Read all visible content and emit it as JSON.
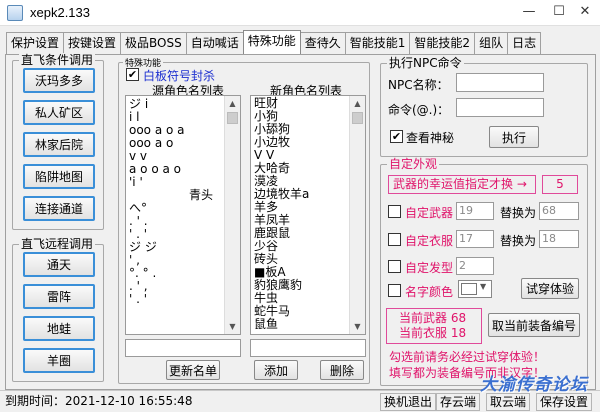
{
  "window": {
    "title": "xepk2.133",
    "minimize": "—",
    "maximize": "☐",
    "close": "✕"
  },
  "tabs": [
    "保护设置",
    "按键设置",
    "极品BOSS",
    "自动喊话",
    "特殊功能",
    "查待久",
    "智能技能1",
    "智能技能2",
    "组队",
    "日志"
  ],
  "active_tab": "特殊功能",
  "left_panel": {
    "group1_title": "直飞条件调用",
    "group1_buttons": [
      "沃玛多多",
      "私人矿区",
      "林家后院",
      "陷阱地图",
      "连接通道"
    ],
    "group2_title": "直飞远程调用",
    "group2_buttons": [
      "通天",
      "雷阵",
      "地蛙",
      "羊圈"
    ]
  },
  "special": {
    "group_title": "特殊功能",
    "white_board_check": "✔",
    "white_board_label": "白板符号封杀",
    "source_list_header": "源角色名列表",
    "source_list_items": [
      "ジ i",
      "i l",
      "ooo a o a",
      "ooo a o",
      "v v",
      "a o o a o",
      " 'i '",
      "青头",
      "へ°",
      ". ' .",
      "' . '",
      "ジ ジ",
      "' ,",
      "°. ° .",
      ". ' ,",
      "' . '"
    ],
    "source_highlight": "青头",
    "new_list_header": "新角色名列表",
    "new_list_items": [
      "旺财",
      "小狗",
      "小舔狗",
      "小边牧",
      "V V",
      "大哈奇",
      "漠凌",
      "边境牧羊a",
      "羊多",
      "羊凤羊",
      "鹿跟鼠",
      "少谷",
      "砖头",
      "■板A",
      "豹狼鹰豹",
      "牛虫",
      "蛇牛马",
      "鼠鱼"
    ],
    "update_button": "更新名单",
    "add_button": "添加",
    "delete_button": "删除"
  },
  "npc": {
    "group_title": "执行NPC命令",
    "npc_name_label": "NPC名称：",
    "npc_name_value": "",
    "command_label": "命令(@.)：",
    "command_value": "",
    "view_mystery_check": "✔",
    "view_mystery_label": "查看神秘",
    "execute_button": "执行"
  },
  "appearance": {
    "group_title": "自定外观",
    "lucky_button": "武器的幸运值指定才换 →",
    "lucky_value": "5",
    "weapon_label": "自定武器",
    "weapon_value": "19",
    "weapon_replace_label": "替换为",
    "weapon_replace_value": "68",
    "cloth_label": "自定衣服",
    "cloth_value": "17",
    "cloth_replace_label": "替换为",
    "cloth_replace_value": "18",
    "hair_label": "自定发型",
    "hair_value": "2",
    "name_color_label": "名字颜色",
    "try_on_button": "试穿体验",
    "current_weapon": "当前武器 68",
    "current_cloth": "当前衣服 18",
    "take_current_button": "取当前装备编号",
    "note1": "勾选前请务必经过试穿体验！",
    "note2": "填写都为装备编号而非汉字！"
  },
  "statusbar": {
    "time_label": "到期时间：2021-12-10 16:55:48",
    "logout_button": "换机退出",
    "save_cloud": "存云端",
    "load_cloud": "取云端",
    "save_settings": "保存设置"
  },
  "watermark": "大渝传奇论坛"
}
